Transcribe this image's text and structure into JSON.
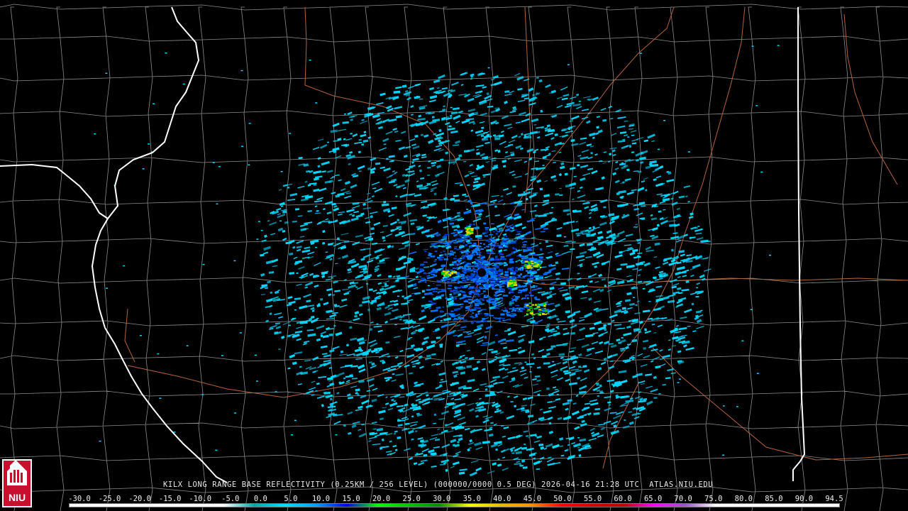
{
  "product": {
    "caption": "KILX LONG RANGE BASE REFLECTIVITY (0.25KM / 256 LEVEL) (000000/0000 0.5 DEG) 2026-04-16 21:28 UTC  ATLAS.NIU.EDU",
    "radar_site": "KILX",
    "timestamp": "2026-04-16 21:28 UTC"
  },
  "logo": {
    "text": "NIU"
  },
  "color_scale": {
    "labels": [
      "-30.0",
      "-25.0",
      "-20.0",
      "-15.0",
      "-10.0",
      "-5.0",
      "0.0",
      "5.0",
      "10.0",
      "15.0",
      "20.0",
      "25.0",
      "30.0",
      "35.0",
      "40.0",
      "45.0",
      "50.0",
      "55.0",
      "60.0",
      "65.0",
      "70.0",
      "75.0",
      "80.0",
      "85.0",
      "90.0",
      "94.5"
    ],
    "colors": [
      "#ffffff",
      "#ffffff",
      "#ffffff",
      "#ffffff",
      "#ffffff",
      "#ffffff",
      "#00a8a8",
      "#00e0ff",
      "#00a0ff",
      "#0000e8",
      "#00ff00",
      "#00c800",
      "#008c00",
      "#ffff00",
      "#e6be00",
      "#ff9000",
      "#ff0000",
      "#d20000",
      "#be0000",
      "#ff00ff",
      "#9955c9",
      "#ffffff",
      "#ffffff",
      "#ffffff",
      "#ffffff",
      "#ffffff"
    ]
  },
  "map_colors": {
    "background": "#000000",
    "state_border": "#ffffff",
    "county_border": "#8c8c8c",
    "highway": "#b4643c",
    "echo_primary": "#00d8ff",
    "echo_secondary": "#0078ff",
    "echo_strong": "#d8d800",
    "radar_site_marker": "#000000"
  }
}
